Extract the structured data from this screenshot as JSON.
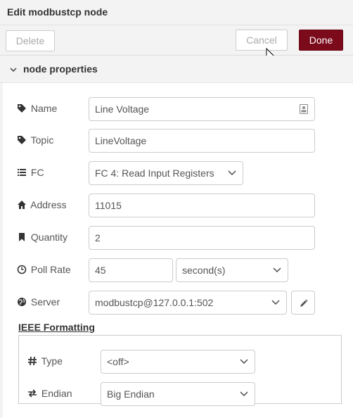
{
  "dialog": {
    "title": "Edit modbustcp node"
  },
  "toolbar": {
    "delete_label": "Delete",
    "cancel_label": "Cancel",
    "done_label": "Done"
  },
  "section": {
    "label": "node properties"
  },
  "fields": {
    "name": {
      "label": "Name",
      "value": "Line Voltage",
      "icon": "tag-icon"
    },
    "topic": {
      "label": "Topic",
      "value": "LineVoltage",
      "icon": "tag-icon"
    },
    "fc": {
      "label": "FC",
      "value": "FC 4: Read Input Registers",
      "icon": "list-icon"
    },
    "address": {
      "label": "Address",
      "value": "11015",
      "icon": "home-icon"
    },
    "quantity": {
      "label": "Quantity",
      "value": "2",
      "icon": "bookmark-icon"
    },
    "poll_rate": {
      "label": "Poll Rate",
      "value": "45",
      "unit": "second(s)",
      "icon": "clock-icon"
    },
    "server": {
      "label": "Server",
      "value": "modbustcp@127.0.0.1:502",
      "icon": "globe-icon"
    }
  },
  "ieee": {
    "title": "IEEE Formatting",
    "type": {
      "label": "Type",
      "value": "<off>",
      "icon": "hash-icon"
    },
    "endian": {
      "label": "Endian",
      "value": "Big Endian",
      "icon": "exchange-icon"
    }
  },
  "colors": {
    "accent": "#7b0b1b",
    "panel": "#f3f3f3",
    "border": "#cccccc"
  }
}
